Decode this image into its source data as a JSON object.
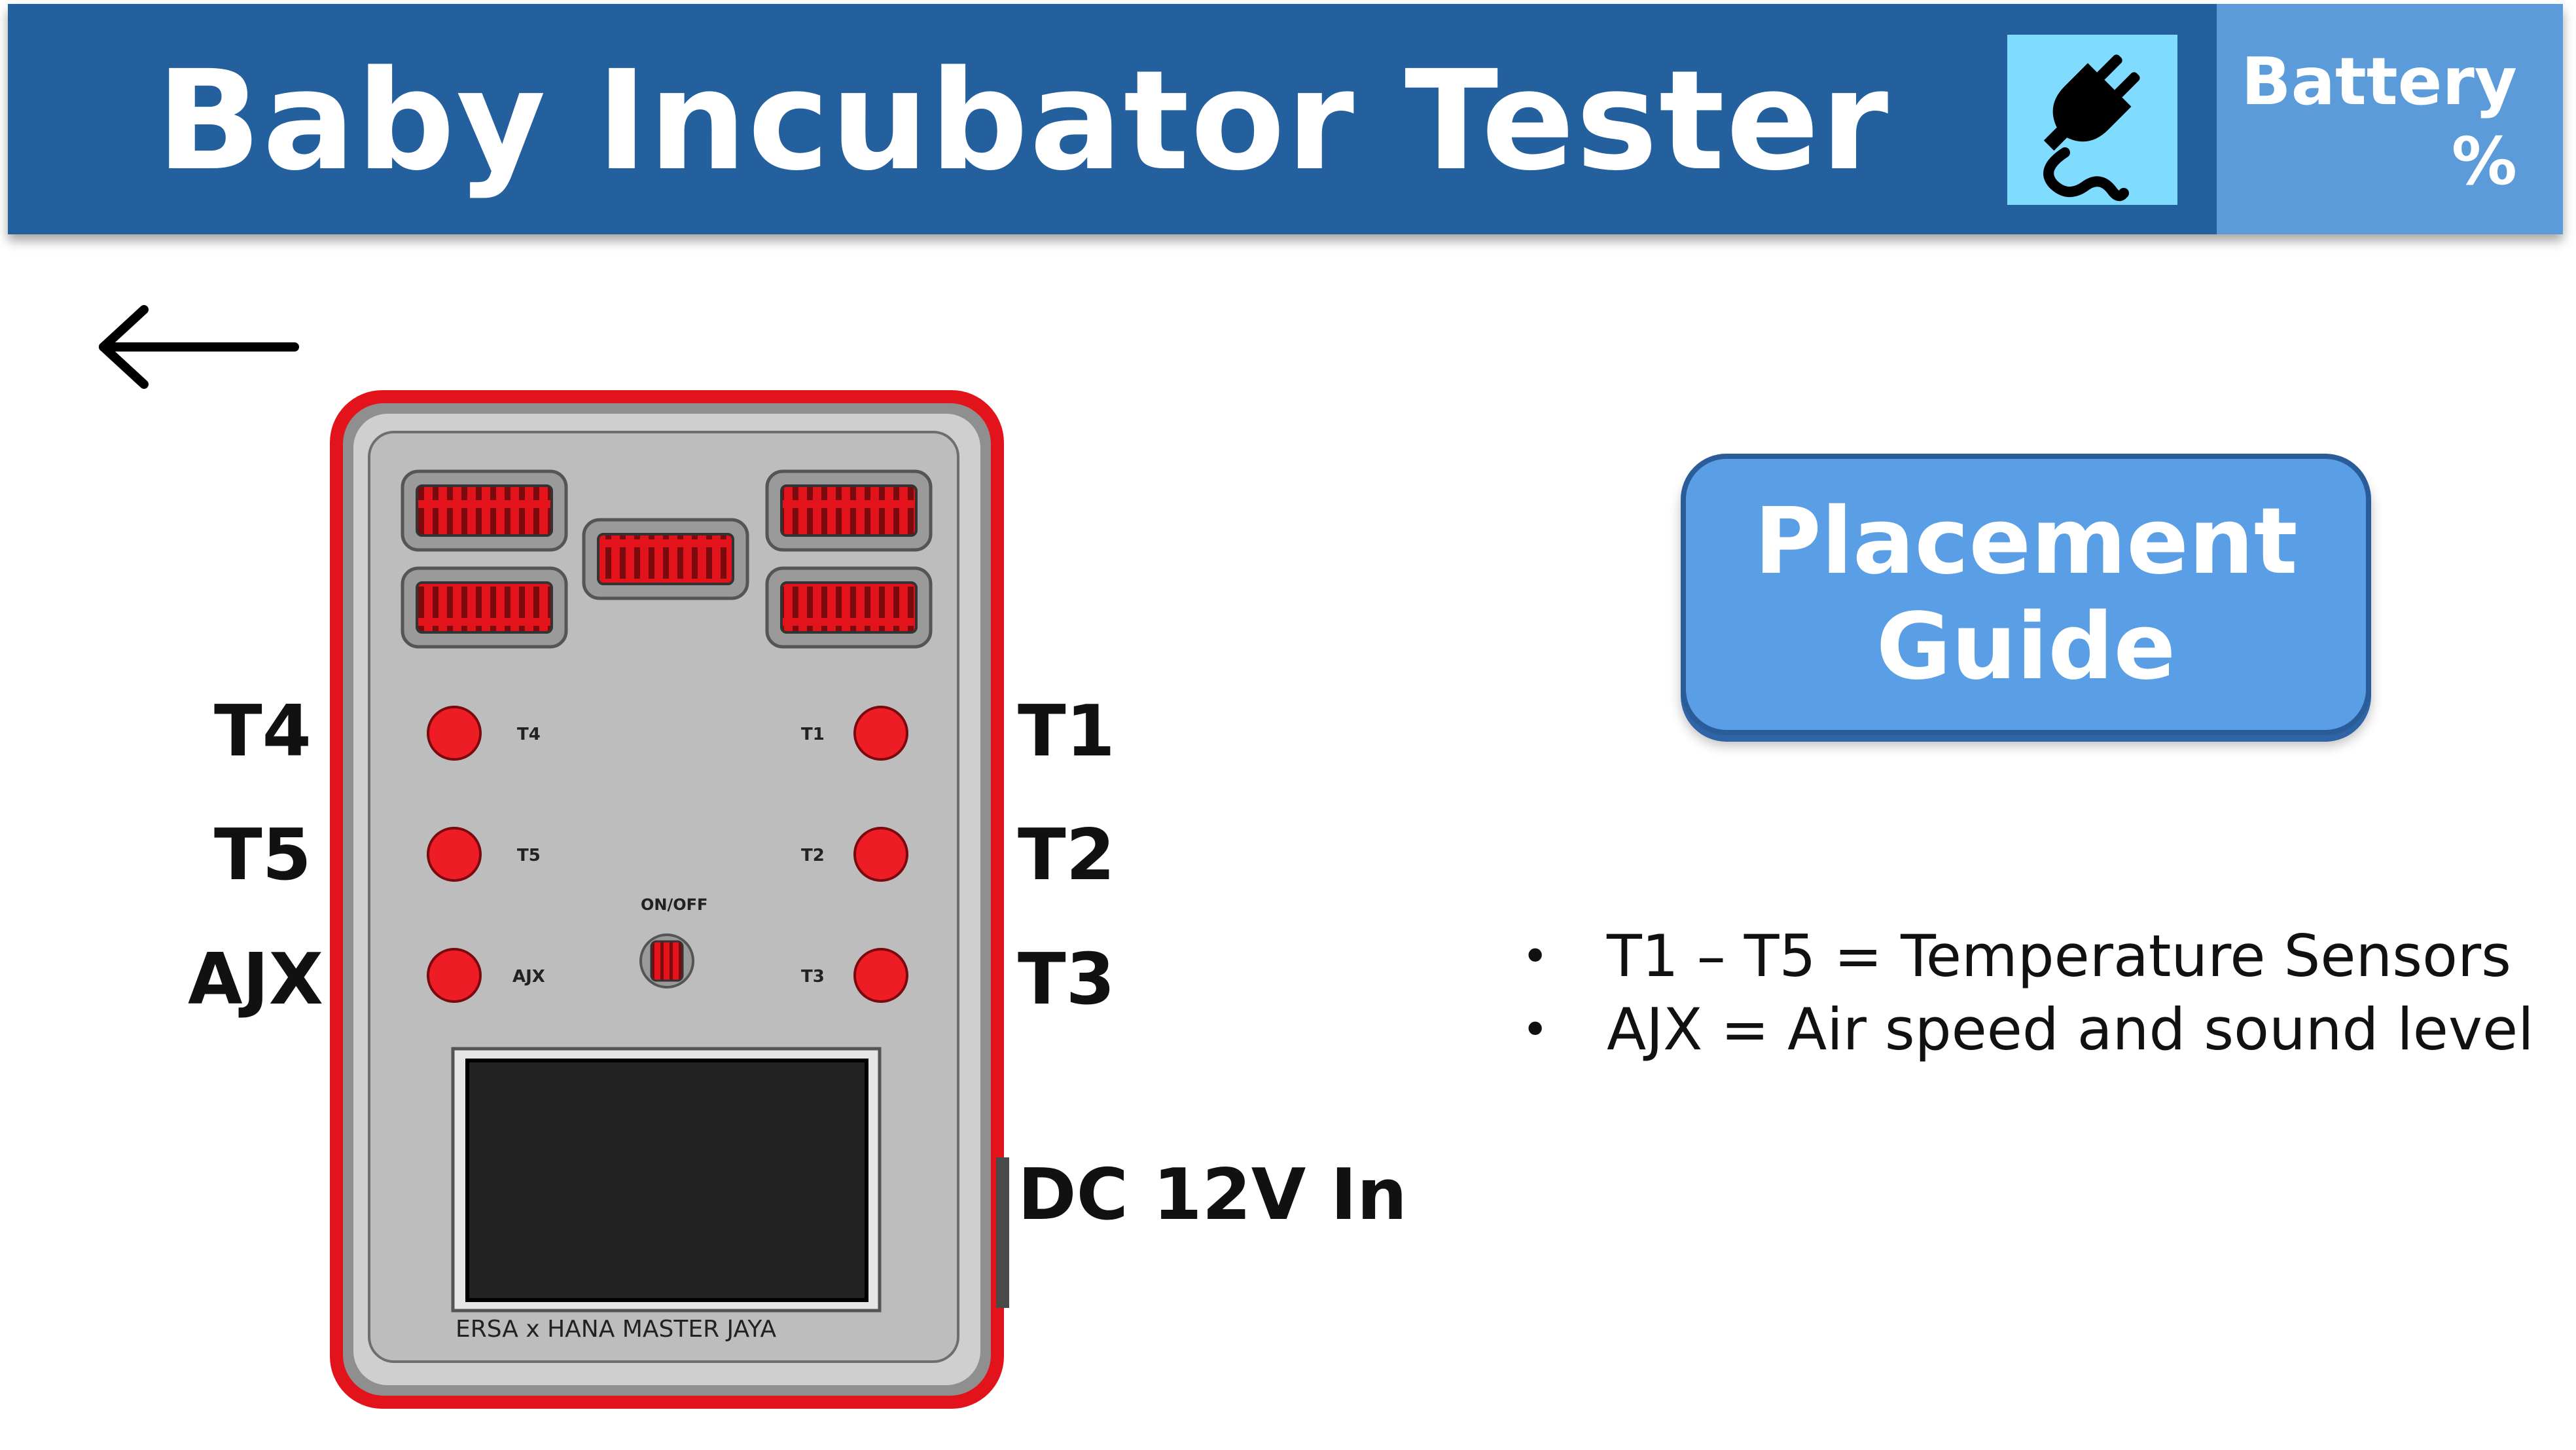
{
  "header": {
    "title": "Baby Incubator Tester",
    "battery_label": "Battery\n%",
    "power_icon": "plug-icon",
    "colors": {
      "bar": "#245f9e",
      "battery_panel": "#5b9bd9",
      "power_tile": "#7fdcff"
    }
  },
  "nav": {
    "back_icon": "back-arrow-icon"
  },
  "device": {
    "brand_text": "ERSA x HANA MASTER JAYA",
    "switch_label": "ON/OFF",
    "panel_labels": {
      "t1": "T1",
      "t2": "T2",
      "t3": "T3",
      "t4": "T4",
      "t5": "T5",
      "ajx": "AJX"
    },
    "colors": {
      "case": "#e3131b",
      "panel": "#bdbdbd",
      "port": "#ee1c24",
      "screen": "#222222"
    }
  },
  "ports": {
    "t1": "T1",
    "t2": "T2",
    "t3": "T3",
    "t4": "T4",
    "t5": "T5",
    "ajx": "AJX",
    "dc": "DC 12V In"
  },
  "placement_guide": {
    "label": "Placement\nGuide"
  },
  "legend": [
    {
      "bullet": "•",
      "text": "T1 – T5 = Temperature Sensors"
    },
    {
      "bullet": "•",
      "text": "AJX = Air speed and sound level"
    }
  ]
}
